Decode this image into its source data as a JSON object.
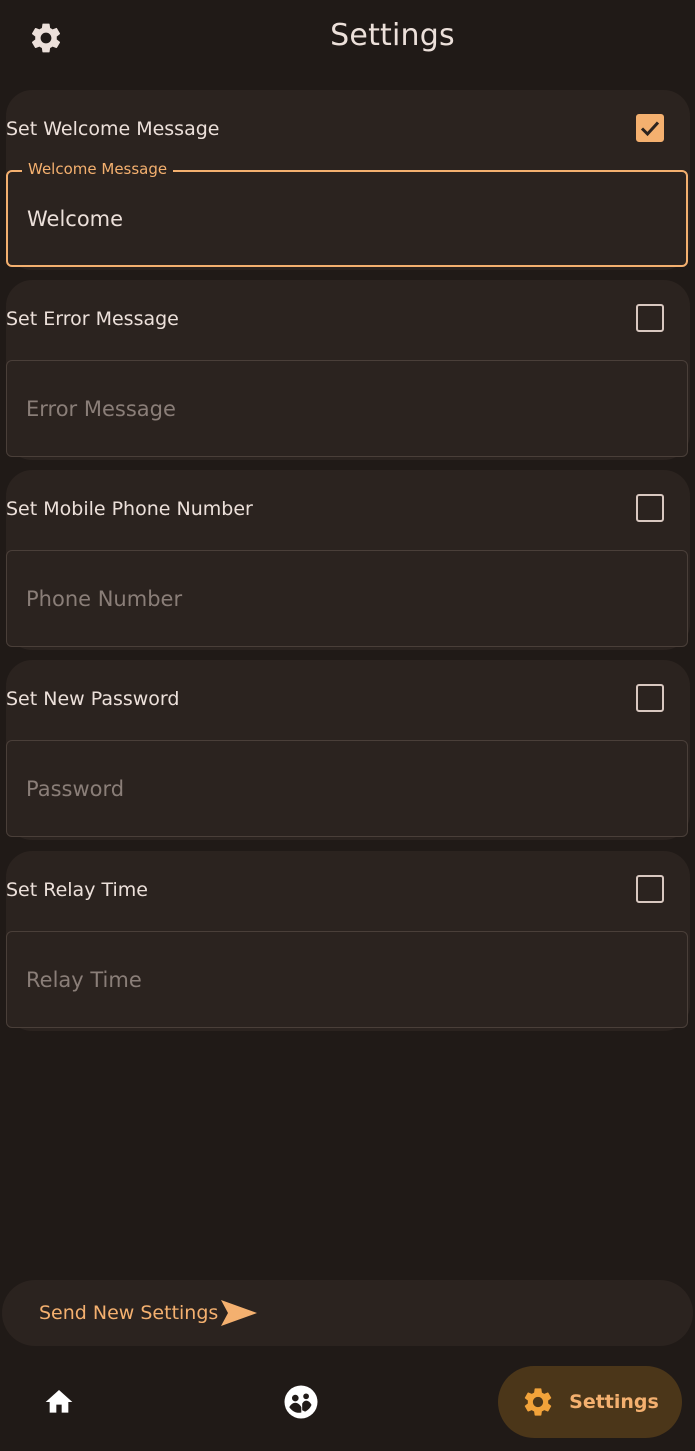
{
  "header": {
    "title": "Settings",
    "settings_icon": "gear-icon"
  },
  "colors": {
    "background": "#201a17",
    "card": "#2b231f",
    "accent": "#f4b06f",
    "text": "#ece0da",
    "placeholder": "#8a7e78",
    "nav_active_bg": "#4b3619"
  },
  "settings": [
    {
      "label": "Set Welcome Message",
      "checked": true,
      "field_legend": "Welcome Message",
      "value": "Welcome",
      "placeholder": ""
    },
    {
      "label": "Set Error Message",
      "checked": false,
      "value": "",
      "placeholder": "Error Message"
    },
    {
      "label": "Set Mobile Phone Number",
      "checked": false,
      "value": "",
      "placeholder": "Phone Number"
    },
    {
      "label": "Set New Password",
      "checked": false,
      "value": "",
      "placeholder": "Password"
    },
    {
      "label": "Set Relay Time",
      "checked": false,
      "value": "",
      "placeholder": "Relay Time"
    }
  ],
  "actions": {
    "send_label": "Send New Settings",
    "send_icon": "send-icon"
  },
  "bottom_nav": {
    "home_icon": "home-icon",
    "community_icon": "community-icon",
    "settings_icon": "gear-icon",
    "settings_label": "Settings",
    "active": "Settings"
  }
}
